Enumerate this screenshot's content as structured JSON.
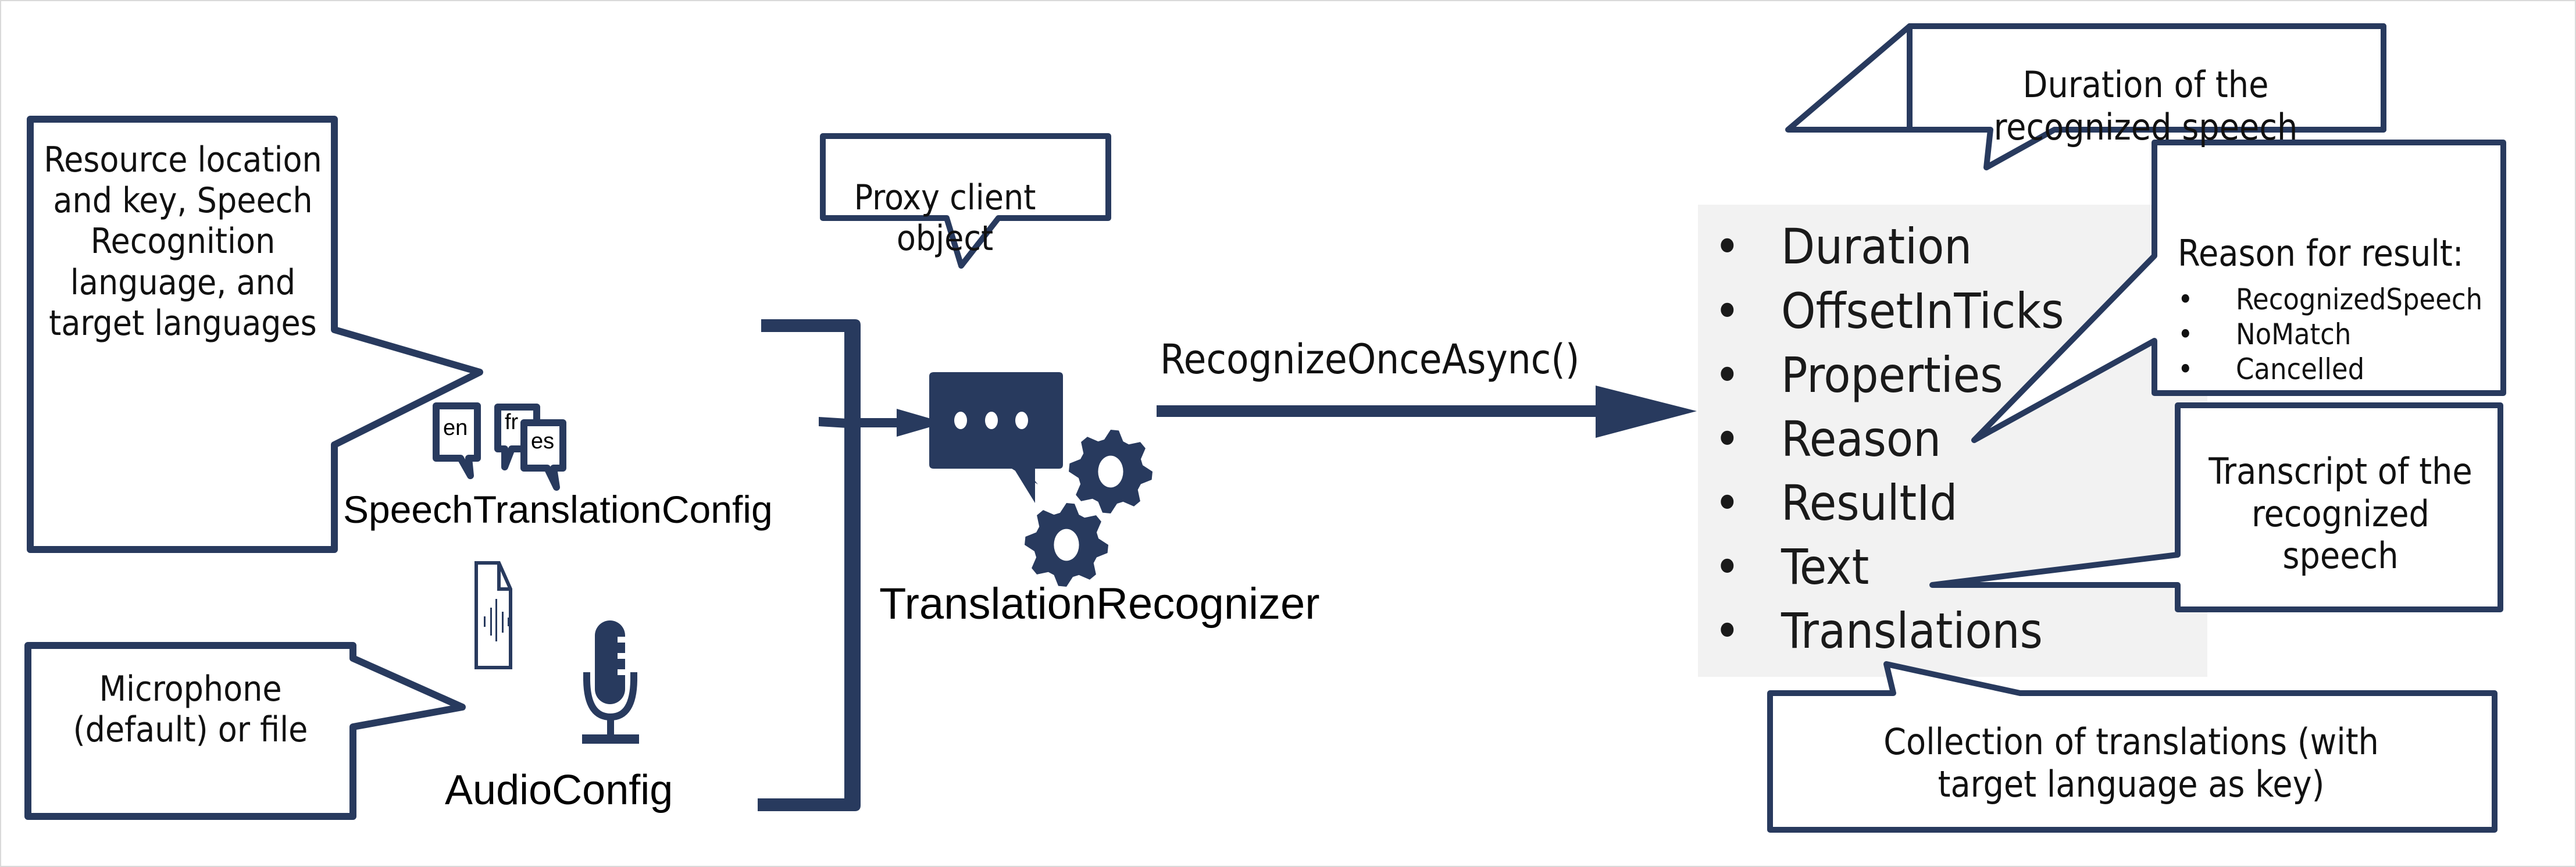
{
  "diagram": {
    "title": "Speech translation recognition flow",
    "colors": {
      "navy": "#283a5e",
      "panel_gray": "#f2f2f2",
      "text": "#111111"
    }
  },
  "inputs": {
    "config_callout": "Resource location and key, Speech Recognition language, and target languages",
    "config_label": "SpeechTranslationConfig",
    "language_bubbles": [
      "en",
      "fr",
      "es"
    ],
    "audio_callout": "Microphone (default) or file",
    "audio_label": "AudioConfig",
    "icons": [
      "speech-bubble-icon",
      "audio-file-icon",
      "microphone-icon"
    ]
  },
  "recognizer": {
    "callout": "Proxy client object",
    "label": "TranslationRecognizer",
    "icons": [
      "chat-icon",
      "gear-icon"
    ]
  },
  "method": {
    "label": "RecognizeOnceAsync()"
  },
  "result": {
    "properties": [
      "Duration",
      "OffsetInTicks",
      "Properties",
      "Reason",
      "ResultId",
      "Text",
      "Translations"
    ],
    "bullet": "•",
    "callouts": {
      "duration": "Duration of the recognized speech",
      "reason_title": "Reason for result:",
      "reason_values": [
        "RecognizedSpeech",
        "NoMatch",
        "Cancelled"
      ],
      "text": "Transcript of the recognized speech",
      "translations": "Collection of translations (with target language as key)"
    }
  }
}
